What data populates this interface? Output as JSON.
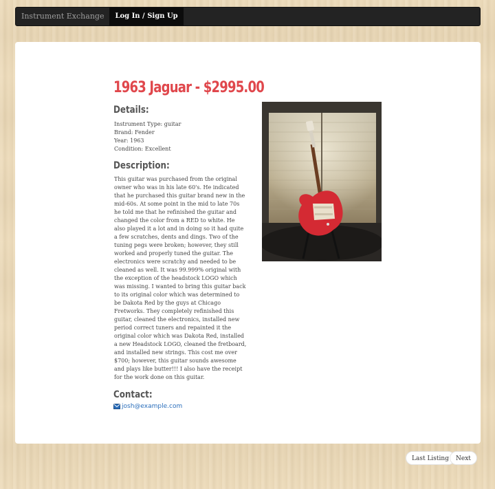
{
  "navbar": {
    "brand": "Instrument Exchange",
    "login_label": "Log In / Sign Up"
  },
  "listing": {
    "title": "1963 Jaguar - $2995.00",
    "details_heading": "Details:",
    "details": [
      "Instrument Type: guitar",
      "Brand: Fender",
      "Year: 1963",
      "Condition: Excellent"
    ],
    "description_heading": "Description:",
    "description": "This guitar was purchased from the original owner who was in his late 60's. He indicated that he purchased this guitar brand new in the mid-60s. At some point in the mid to late 70s he told me that he refinished the guitar and changed the color from a RED to white. He also played it a lot and in doing so it had quite a few scratches, dents and dings. Two of the tuning pegs were broken; however, they still worked and properly tuned the guitar. The electronics were scratchy and needed to be cleaned as well. It was 99.999% original with the exception of the headstock LOGO which was missing. I wanted to bring this guitar back to its original color which was determined to be Dakota Red by the guys at Chicago Fretworks. They completely refinished this guitar, cleaned the electronics, installed new period correct tuners and repainted it the original color which was Dakota Red, installed a new Headstock LOGO, cleaned the fretboard, and installed new strings. This cost me over $700; however, this guitar sounds awesome and plays like butter!!! I also have the receipt for the work done on this guitar.",
    "contact_heading": "Contact:",
    "contact_email": "josh@example.com",
    "contact_icon": "envelope-icon"
  },
  "pager": {
    "last_label": "Last Listing",
    "next_label": "Next"
  }
}
